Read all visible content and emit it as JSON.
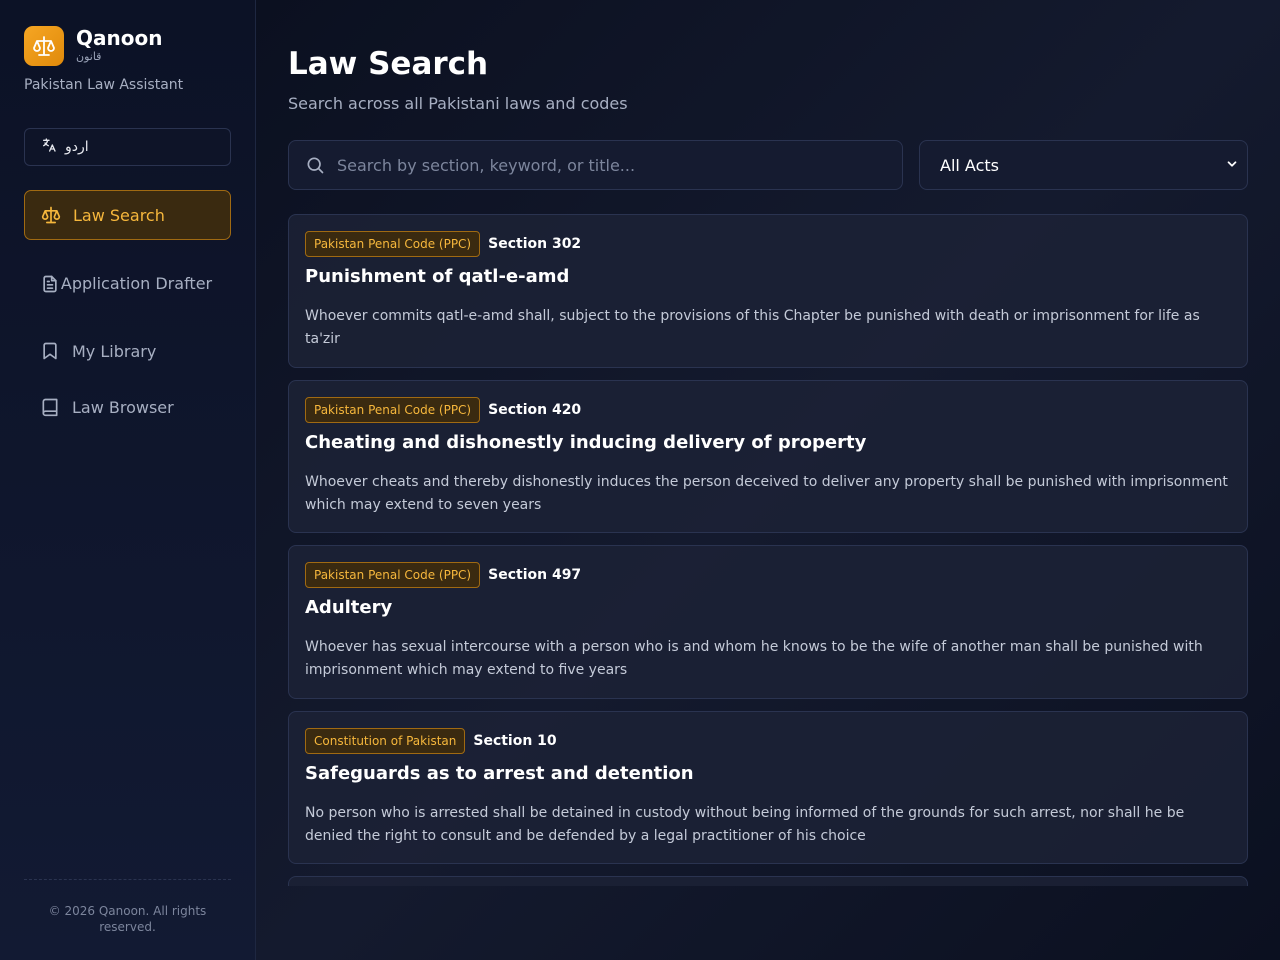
{
  "brand": {
    "name": "Qanoon",
    "urdu": "قانون",
    "tagline": "Pakistan Law Assistant"
  },
  "language_toggle": {
    "label": "اردو",
    "icon": "translate-icon"
  },
  "nav": {
    "items": [
      {
        "label": "Law Search",
        "icon": "scales-icon",
        "active": true
      },
      {
        "label": "Application Drafter",
        "icon": "document-icon",
        "active": false
      },
      {
        "label": "My Library",
        "icon": "bookmark-icon",
        "active": false
      },
      {
        "label": "Law Browser",
        "icon": "book-icon",
        "active": false
      }
    ]
  },
  "footer": {
    "copyright": "© 2026 Qanoon. All rights reserved."
  },
  "main": {
    "title": "Law Search",
    "subtitle": "Search across all Pakistani laws and codes",
    "search": {
      "placeholder": "Search by section, keyword, or title...",
      "value": ""
    },
    "filter": {
      "selected": "All Acts"
    }
  },
  "results": [
    {
      "act": "Pakistan Penal Code (PPC)",
      "section": "Section 302",
      "title": "Punishment of qatl-e-amd",
      "description": "Whoever commits qatl-e-amd shall, subject to the provisions of this Chapter be punished with death or imprisonment for life as ta'zir"
    },
    {
      "act": "Pakistan Penal Code (PPC)",
      "section": "Section 420",
      "title": "Cheating and dishonestly inducing delivery of property",
      "description": "Whoever cheats and thereby dishonestly induces the person deceived to deliver any property shall be punished with imprisonment which may extend to seven years"
    },
    {
      "act": "Pakistan Penal Code (PPC)",
      "section": "Section 497",
      "title": "Adultery",
      "description": "Whoever has sexual intercourse with a person who is and whom he knows to be the wife of another man shall be punished with imprisonment which may extend to five years"
    },
    {
      "act": "Constitution of Pakistan",
      "section": "Section 10",
      "title": "Safeguards as to arrest and detention",
      "description": "No person who is arrested shall be detained in custody without being informed of the grounds for such arrest, nor shall he be denied the right to consult and be defended by a legal practitioner of his choice"
    }
  ],
  "colors": {
    "accent": "#f6b73c",
    "background": "#0b1020",
    "card": "#1c2236"
  }
}
